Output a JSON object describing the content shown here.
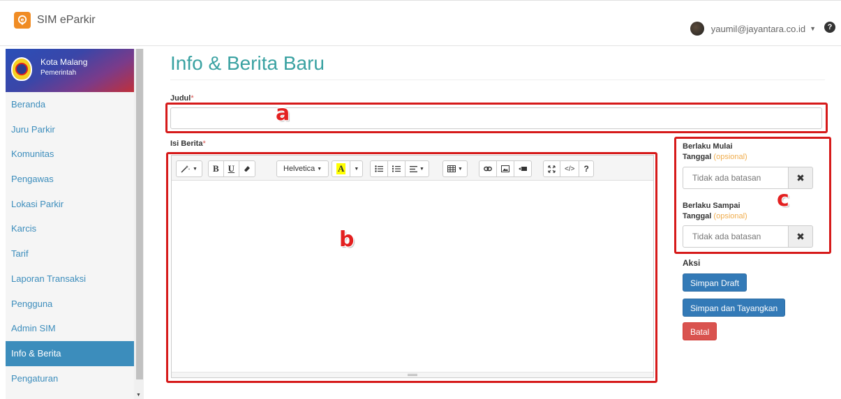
{
  "app": {
    "title": "SIM eParkir"
  },
  "user": {
    "email": "yaumil@jayantara.co.id"
  },
  "org": {
    "name": "Kota Malang",
    "subtitle": "Pemerintah"
  },
  "sidebar": {
    "items": [
      {
        "label": "Beranda",
        "active": false
      },
      {
        "label": "Juru Parkir",
        "active": false
      },
      {
        "label": "Komunitas",
        "active": false
      },
      {
        "label": "Pengawas",
        "active": false
      },
      {
        "label": "Lokasi Parkir",
        "active": false
      },
      {
        "label": "Karcis",
        "active": false
      },
      {
        "label": "Tarif",
        "active": false
      },
      {
        "label": "Laporan Transaksi",
        "active": false
      },
      {
        "label": "Pengguna",
        "active": false
      },
      {
        "label": "Admin SIM",
        "active": false
      },
      {
        "label": "Info & Berita",
        "active": true
      },
      {
        "label": "Pengaturan",
        "active": false
      }
    ]
  },
  "page": {
    "title": "Info & Berita Baru"
  },
  "form": {
    "judul_label": "Judul",
    "judul_value": "",
    "isi_label": "Isi Berita",
    "required_mark": "*",
    "font_name": "Helvetica",
    "mulai_label_line1": "Berlaku Mulai",
    "mulai_label_line2": "Tanggal",
    "sampai_label_line1": "Berlaku Sampai",
    "sampai_label_line2": "Tanggal",
    "optional_text": "(opsional)",
    "date_placeholder": "Tidak ada batasan",
    "aksi_label": "Aksi"
  },
  "actions": {
    "draft": "Simpan Draft",
    "publish": "Simpan dan Tayangkan",
    "cancel": "Batal"
  },
  "annotations": {
    "a": "a",
    "b": "b",
    "c": "c"
  },
  "colors": {
    "accent": "#3c8dbc",
    "title": "#3aa2a2",
    "primary": "#337ab7",
    "danger": "#d9534f",
    "annotation": "#d61a1a"
  }
}
